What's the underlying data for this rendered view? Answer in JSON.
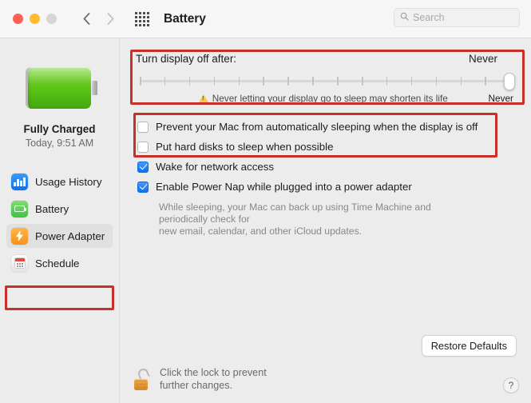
{
  "window": {
    "title": "Battery",
    "traffic_lights": [
      "close-red",
      "minimize-yellow",
      "zoom-gray-disabled"
    ],
    "nav": {
      "back": "‹",
      "forward": "›"
    },
    "grid_icon": "apps-grid-icon"
  },
  "search": {
    "placeholder": "Search",
    "icon": "search-icon"
  },
  "sidebar": {
    "battery_icon": "green-battery-full-icon",
    "status": "Fully Charged",
    "timestamp": "Today, 9:51 AM",
    "items": [
      {
        "label": "Usage History",
        "icon": "usage-history-icon",
        "selected": false
      },
      {
        "label": "Battery",
        "icon": "battery-icon",
        "selected": false
      },
      {
        "label": "Power Adapter",
        "icon": "power-adapter-icon",
        "selected": true
      },
      {
        "label": "Schedule",
        "icon": "schedule-icon",
        "selected": false
      }
    ]
  },
  "main": {
    "slider": {
      "label": "Turn display off after:",
      "value": "Never",
      "track_end_label": "Never",
      "tick_count": 16,
      "knob_position_pct": 100,
      "warning_icon": "warning-triangle-icon",
      "warning_text": "Never letting your display go to sleep may shorten its life"
    },
    "checkboxes": [
      {
        "label": "Prevent your Mac from automatically sleeping when the display is off",
        "checked": false
      },
      {
        "label": "Put hard disks to sleep when possible",
        "checked": false
      },
      {
        "label": "Wake for network access",
        "checked": true
      },
      {
        "label": "Enable Power Nap while plugged into a power adapter",
        "checked": true
      }
    ],
    "power_nap_description_line1": "While sleeping, your Mac can back up using Time Machine and periodically check for",
    "power_nap_description_line2": "new email, calendar, and other iCloud updates.",
    "restore_defaults_label": "Restore Defaults",
    "lock": {
      "icon": "unlocked-padlock-icon",
      "line1": "Click the lock to prevent",
      "line2": "further changes."
    },
    "help_label": "?"
  },
  "annotations": {
    "color": "#c9302c",
    "boxes": [
      "display-sleep-slider",
      "sleep-checkboxes",
      "power-adapter-sidebar-item"
    ]
  }
}
